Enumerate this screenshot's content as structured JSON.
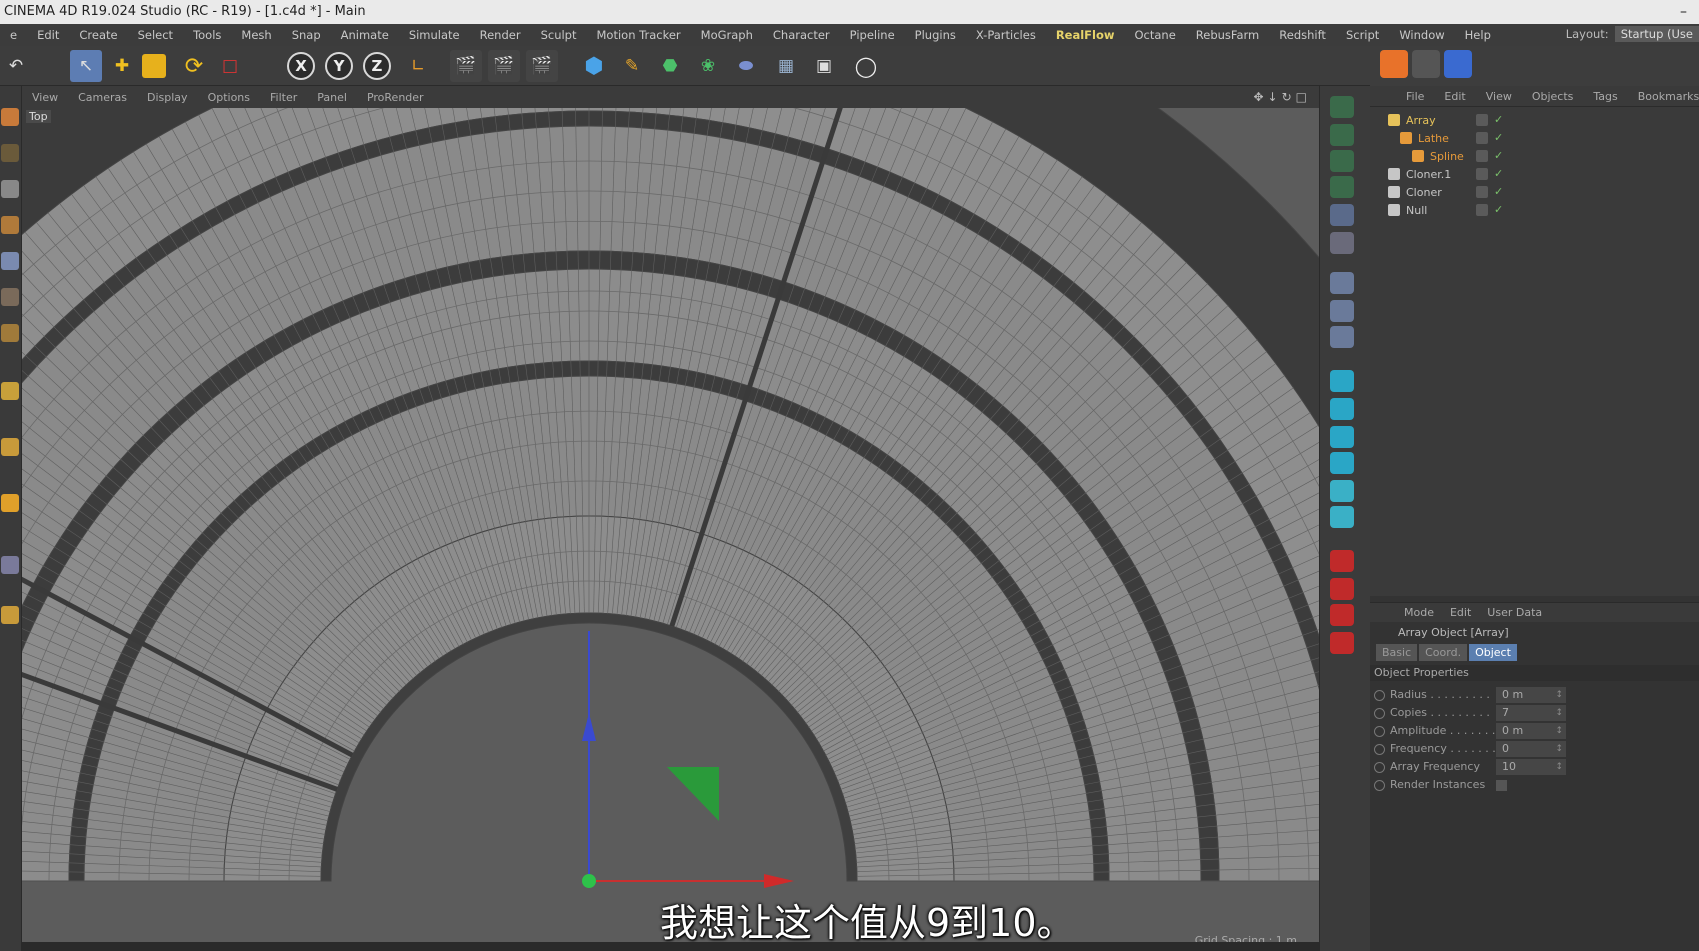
{
  "window": {
    "title": "CINEMA 4D R19.024 Studio (RC - R19) - [1.c4d *] - Main",
    "minimize_label": "–"
  },
  "menu": {
    "items": [
      "e",
      "Edit",
      "Create",
      "Select",
      "Tools",
      "Mesh",
      "Snap",
      "Animate",
      "Simulate",
      "Render",
      "Sculpt",
      "Motion Tracker",
      "MoGraph",
      "Character",
      "Pipeline",
      "Plugins",
      "X-Particles",
      "RealFlow",
      "Octane",
      "RebusFarm",
      "Redshift",
      "Script",
      "Window",
      "Help"
    ],
    "highlight": "RealFlow",
    "layout_label": "Layout:",
    "layout_value": "Startup (Use"
  },
  "toolbar": {
    "axis_x": "X",
    "axis_y": "Y",
    "axis_z": "Z"
  },
  "viewport": {
    "menu": [
      "View",
      "Cameras",
      "Display",
      "Options",
      "Filter",
      "Panel",
      "ProRender"
    ],
    "nav_icons": "✥↓↻□",
    "label": "Top",
    "grid_spacing": "Grid Spacing : 1 m",
    "subtitle": "我想让这个值从9到10。"
  },
  "objects": {
    "menu": [
      "File",
      "Edit",
      "View",
      "Objects",
      "Tags",
      "Bookmarks"
    ],
    "rows": [
      {
        "name": "Array",
        "indent": 0,
        "color": "#e6c25a"
      },
      {
        "name": "Lathe",
        "indent": 1,
        "color": "#e69a3a"
      },
      {
        "name": "Spline",
        "indent": 2,
        "color": "#e69a3a"
      },
      {
        "name": "Cloner.1",
        "indent": 0,
        "color": "#c6c6c6"
      },
      {
        "name": "Cloner",
        "indent": 0,
        "color": "#c6c6c6"
      },
      {
        "name": "Null",
        "indent": 0,
        "color": "#c6c6c6"
      }
    ]
  },
  "attributes": {
    "menu": [
      "Mode",
      "Edit",
      "User Data"
    ],
    "title": "Array Object [Array]",
    "tabs": [
      "Basic",
      "Coord.",
      "Object"
    ],
    "active_tab": "Object",
    "section": "Object Properties",
    "props": [
      {
        "label": "Radius . . . . . . . . .",
        "value": "0 m"
      },
      {
        "label": "Copies . . . . . . . . .",
        "value": "7"
      },
      {
        "label": "Amplitude . . . . . . .",
        "value": "0 m"
      },
      {
        "label": "Frequency . . . . . . .",
        "value": "0"
      },
      {
        "label": "Array Frequency",
        "value": "10"
      },
      {
        "label": "Render Instances",
        "value": null
      }
    ]
  },
  "colors": {
    "accent": "#5b7fb0",
    "highlight_menu": "#e6d36a",
    "viewport_bg": "#555555"
  }
}
